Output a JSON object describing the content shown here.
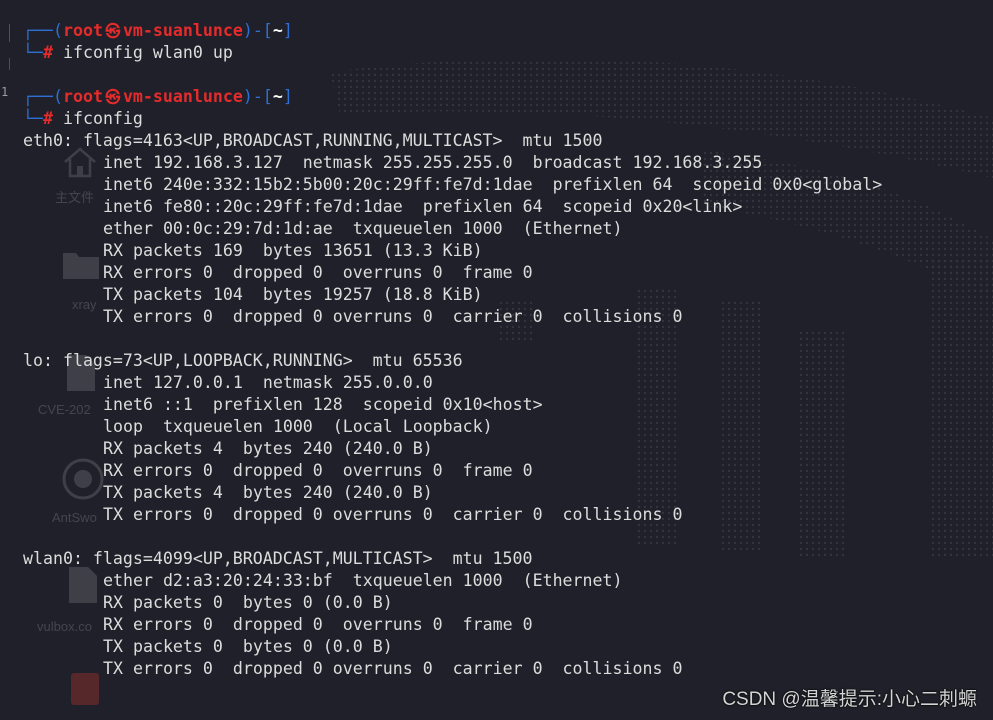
{
  "terminal": {
    "colors": {
      "background": "#1f2029",
      "foreground": "#dcdcdc",
      "prompt_blue": "#2e6fd3",
      "prompt_red": "#e52b2b"
    },
    "prompt_glyphs": {
      "open": "┌──(",
      "sep": ")-[",
      "close": "]",
      "corner": "└─",
      "symbol": "#"
    },
    "prompts": [
      {
        "user": "root",
        "at_symbol": "㉿",
        "host": "vm-suanlunce",
        "cwd": "~",
        "command": "ifconfig wlan0 up"
      },
      {
        "user": "root",
        "at_symbol": "㉿",
        "host": "vm-suanlunce",
        "cwd": "~",
        "command": "ifconfig"
      }
    ],
    "interfaces": [
      {
        "header": "eth0: flags=4163<UP,BROADCAST,RUNNING,MULTICAST>  mtu 1500",
        "details": [
          "inet 192.168.3.127  netmask 255.255.255.0  broadcast 192.168.3.255",
          "inet6 240e:332:15b2:5b00:20c:29ff:fe7d:1dae  prefixlen 64  scopeid 0x0<global>",
          "inet6 fe80::20c:29ff:fe7d:1dae  prefixlen 64  scopeid 0x20<link>",
          "ether 00:0c:29:7d:1d:ae  txqueuelen 1000  (Ethernet)",
          "RX packets 169  bytes 13651 (13.3 KiB)",
          "RX errors 0  dropped 0  overruns 0  frame 0",
          "TX packets 104  bytes 19257 (18.8 KiB)",
          "TX errors 0  dropped 0 overruns 0  carrier 0  collisions 0"
        ]
      },
      {
        "header": "lo: flags=73<UP,LOOPBACK,RUNNING>  mtu 65536",
        "details": [
          "inet 127.0.0.1  netmask 255.0.0.0",
          "inet6 ::1  prefixlen 128  scopeid 0x10<host>",
          "loop  txqueuelen 1000  (Local Loopback)",
          "RX packets 4  bytes 240 (240.0 B)",
          "RX errors 0  dropped 0  overruns 0  frame 0",
          "TX packets 4  bytes 240 (240.0 B)",
          "TX errors 0  dropped 0 overruns 0  carrier 0  collisions 0"
        ]
      },
      {
        "header": "wlan0: flags=4099<UP,BROADCAST,MULTICAST>  mtu 1500",
        "details": [
          "ether d2:a3:20:24:33:bf  txqueuelen 1000  (Ethernet)",
          "RX packets 0  bytes 0 (0.0 B)",
          "RX errors 0  dropped 0  overruns 0  frame 0",
          "TX packets 0  bytes 0 (0.0 B)",
          "TX errors 0  dropped 0 overruns 0  carrier 0  collisions 0"
        ]
      }
    ]
  },
  "desktop_icons": [
    {
      "icon": "home-icon",
      "label": "主文件"
    },
    {
      "icon": "folder-icon",
      "label": "xray"
    },
    {
      "icon": "file-icon",
      "label": "CVE-202"
    },
    {
      "icon": "antsword-icon",
      "label": "AntSwo"
    },
    {
      "icon": "file-icon",
      "label": "vulbox.co"
    },
    {
      "icon": "app-icon",
      "label": ""
    }
  ],
  "edge_marker": "1",
  "watermark": "CSDN @温馨提示:小心二刺螈"
}
